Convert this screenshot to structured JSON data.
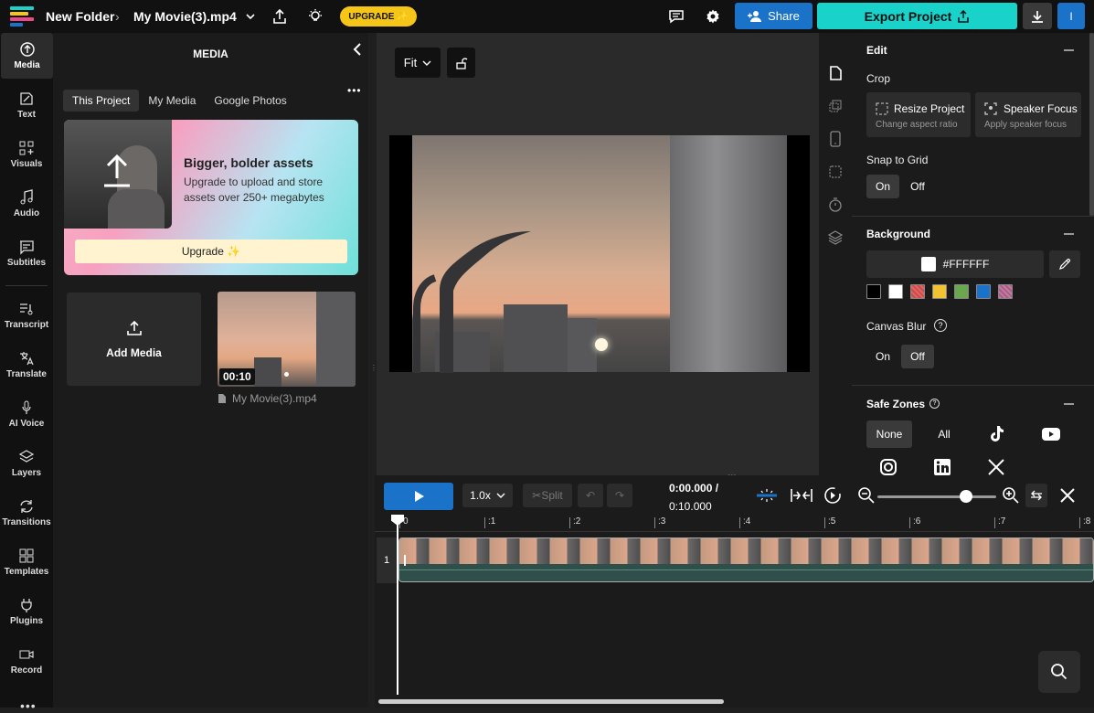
{
  "header": {
    "folder": "New Folder",
    "project": "My Movie(3).mp4",
    "upgrade_label": "UPGRADE ✨",
    "share_label": "Share",
    "export_label": "Export Project",
    "account_label": "I"
  },
  "rail": [
    {
      "label": "Media",
      "icon": "upload-icon"
    },
    {
      "label": "Text",
      "icon": "text-icon"
    },
    {
      "label": "Visuals",
      "icon": "visuals-icon"
    },
    {
      "label": "Audio",
      "icon": "music-icon"
    },
    {
      "label": "Subtitles",
      "icon": "subtitles-icon"
    },
    {
      "label": "Transcript",
      "icon": "transcript-icon"
    },
    {
      "label": "Translate",
      "icon": "translate-icon"
    },
    {
      "label": "AI Voice",
      "icon": "mic-icon"
    },
    {
      "label": "Layers",
      "icon": "layers-icon"
    },
    {
      "label": "Transitions",
      "icon": "transitions-icon"
    },
    {
      "label": "Templates",
      "icon": "templates-icon"
    },
    {
      "label": "Plugins",
      "icon": "plug-icon"
    },
    {
      "label": "Record",
      "icon": "record-icon"
    }
  ],
  "media": {
    "title": "MEDIA",
    "tabs": [
      "This Project",
      "My Media",
      "Google Photos"
    ],
    "promo_title": "Bigger, bolder assets",
    "promo_text": "Upgrade to upload and store assets over 250+ megabytes",
    "promo_button": "Upgrade ✨",
    "add_media": "Add Media",
    "clip_duration": "00:10",
    "clip_name": "My Movie(3).mp4"
  },
  "stage": {
    "fit_label": "Fit"
  },
  "edit": {
    "title": "Edit",
    "crop_label": "Crop",
    "resize_title": "Resize Project",
    "resize_sub": "Change aspect ratio",
    "speaker_title": "Speaker Focus",
    "speaker_sub": "Apply speaker focus",
    "snap_label": "Snap to Grid",
    "on": "On",
    "off": "Off"
  },
  "background": {
    "title": "Background",
    "hex": "#FFFFFF",
    "swatches": [
      "#000000",
      "#FFFFFF",
      "#E06666",
      "#F1C232",
      "#6AA84F",
      "#1A73C8",
      "#C27BA0"
    ],
    "blur_label": "Canvas Blur",
    "on": "On",
    "off": "Off"
  },
  "safe_zones": {
    "title": "Safe Zones",
    "none": "None",
    "all": "All"
  },
  "timeline": {
    "speed": "1.0x",
    "split": "✂Split",
    "current_time": "0:00.000 /",
    "total_time": "0:10.000",
    "track_number": "1",
    "ticks": [
      "0",
      ":1",
      ":2",
      ":3",
      ":4",
      ":5",
      ":6",
      ":7",
      ":8"
    ]
  }
}
